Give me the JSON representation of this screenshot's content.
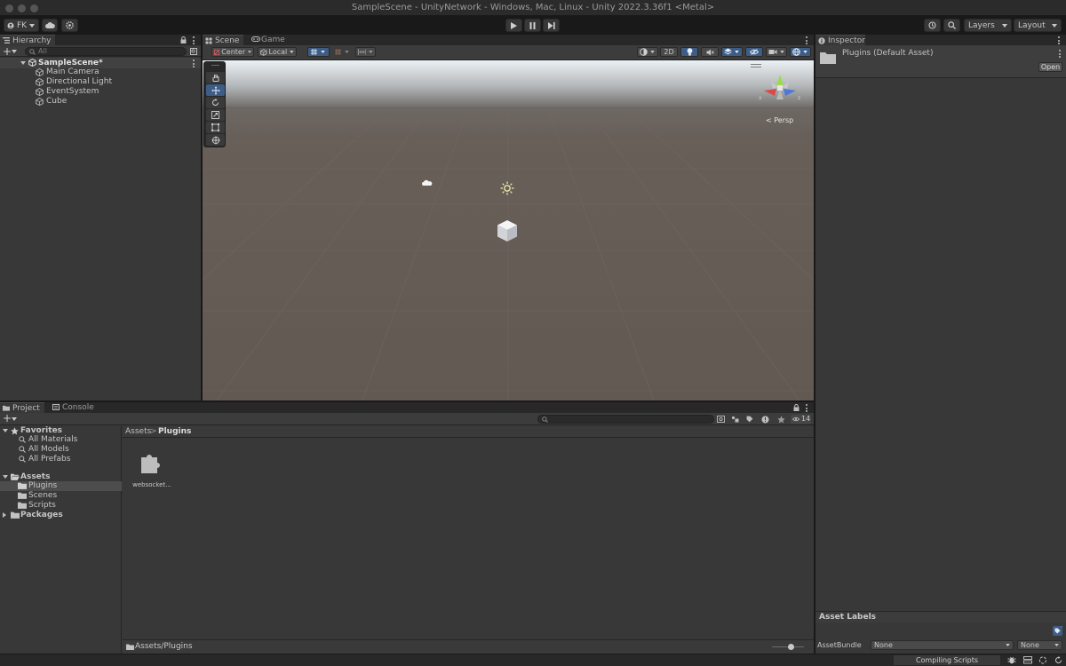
{
  "window": {
    "title": "SampleScene - UnityNetwork - Windows, Mac, Linux - Unity 2022.3.36f1 <Metal>"
  },
  "toolbar": {
    "account_label": "FK",
    "layers_label": "Layers",
    "layout_label": "Layout"
  },
  "hierarchy": {
    "tab_label": "Hierarchy",
    "search_placeholder": "All",
    "scene_name": "SampleScene*",
    "items": [
      "Main Camera",
      "Directional Light",
      "EventSystem",
      "Cube"
    ]
  },
  "scene": {
    "tabs": [
      "Scene",
      "Game"
    ],
    "pivot_label": "Center",
    "space_label": "Local",
    "mode_2d_label": "2D",
    "gizmo_x_label": "x",
    "gizmo_z_label": "z",
    "projection_label": "< Persp"
  },
  "inspector": {
    "tab_label": "Inspector",
    "asset_title": "Plugins (Default Asset)",
    "open_button": "Open",
    "asset_labels_title": "Asset Labels",
    "asset_bundle_label": "AssetBundle",
    "asset_bundle_value": "None",
    "asset_bundle_variant": "None"
  },
  "project": {
    "tabs": [
      "Project",
      "Console"
    ],
    "hidden_count": "14",
    "favorites_label": "Favorites",
    "favorites": [
      "All Materials",
      "All Models",
      "All Prefabs"
    ],
    "assets_label": "Assets",
    "asset_folders": [
      "Plugins",
      "Scenes",
      "Scripts"
    ],
    "packages_label": "Packages",
    "breadcrumb": [
      "Assets",
      "Plugins"
    ],
    "breadcrumb_sep": ">",
    "files": [
      "websocket..."
    ],
    "footer_path": "Assets/Plugins"
  },
  "status": {
    "compiling_text": "Compiling Scripts"
  },
  "colors": {
    "accent_blue": "#3d5d86",
    "panel_bg": "#383838",
    "selection_bg": "#4d4d4d"
  }
}
